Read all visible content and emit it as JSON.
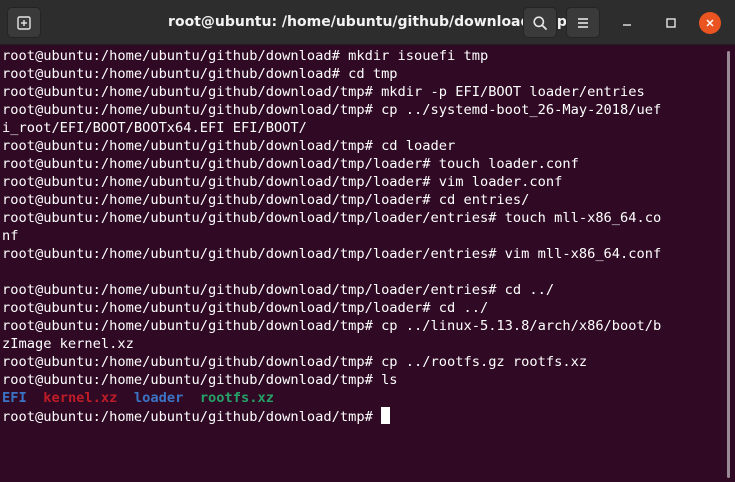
{
  "window": {
    "title": "root@ubuntu: /home/ubuntu/github/download/tmp",
    "accent_color": "#e95420",
    "background_color": "#300a24"
  },
  "titlebar": {
    "new_tab_icon": "new-tab-icon",
    "search_icon": "search-icon",
    "menu_icon": "hamburger-menu-icon",
    "minimize_icon": "minimize-icon",
    "maximize_icon": "maximize-icon",
    "close_icon": "close-icon"
  },
  "terminal": {
    "lines": [
      "root@ubuntu:/home/ubuntu/github/download# mkdir isouefi tmp",
      "root@ubuntu:/home/ubuntu/github/download# cd tmp",
      "root@ubuntu:/home/ubuntu/github/download/tmp# mkdir -p EFI/BOOT loader/entries",
      "root@ubuntu:/home/ubuntu/github/download/tmp# cp ../systemd-boot_26-May-2018/uef",
      "i_root/EFI/BOOT/BOOTx64.EFI EFI/BOOT/",
      "root@ubuntu:/home/ubuntu/github/download/tmp# cd loader",
      "root@ubuntu:/home/ubuntu/github/download/tmp/loader# touch loader.conf",
      "root@ubuntu:/home/ubuntu/github/download/tmp/loader# vim loader.conf",
      "root@ubuntu:/home/ubuntu/github/download/tmp/loader# cd entries/",
      "root@ubuntu:/home/ubuntu/github/download/tmp/loader/entries# touch mll-x86_64.co",
      "nf",
      "root@ubuntu:/home/ubuntu/github/download/tmp/loader/entries# vim mll-x86_64.conf",
      "",
      "root@ubuntu:/home/ubuntu/github/download/tmp/loader/entries# cd ../",
      "root@ubuntu:/home/ubuntu/github/download/tmp/loader# cd ../",
      "root@ubuntu:/home/ubuntu/github/download/tmp# cp ../linux-5.13.8/arch/x86/boot/b",
      "zImage kernel.xz",
      "root@ubuntu:/home/ubuntu/github/download/tmp# cp ../rootfs.gz rootfs.xz",
      "root@ubuntu:/home/ubuntu/github/download/tmp# ls"
    ],
    "ls_output": {
      "dir_efi": "EFI",
      "file_kernel": "kernel.xz",
      "dir_loader": "loader",
      "file_rootfs": "rootfs.xz",
      "color_dir": "#3b74c7",
      "color_archive": "#c01c28",
      "color_exec": "#26a269"
    },
    "prompt": "root@ubuntu:/home/ubuntu/github/download/tmp# "
  }
}
